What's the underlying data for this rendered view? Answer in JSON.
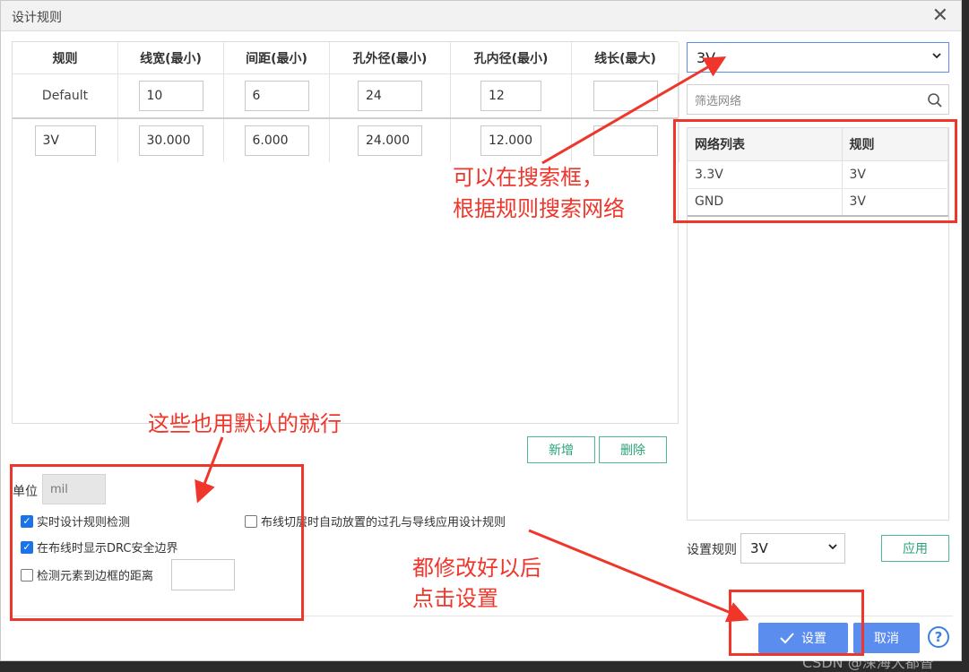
{
  "dialog": {
    "title": "设计规则",
    "close_icon": "close-icon"
  },
  "rules_table": {
    "headers": [
      "规则",
      "线宽(最小)",
      "间距(最小)",
      "孔外径(最小)",
      "孔内径(最小)",
      "线长(最大)"
    ],
    "rows": [
      {
        "name": "Default",
        "width": "10",
        "spacing": "6",
        "via_outer": "24",
        "via_inner": "12",
        "length": ""
      },
      {
        "name": "3V",
        "width": "30.000",
        "spacing": "6.000",
        "via_outer": "24.000",
        "via_inner": "12.000",
        "length": ""
      }
    ],
    "add_label": "新增",
    "delete_label": "删除"
  },
  "settings": {
    "unit_label": "单位",
    "unit_value": "mil",
    "realtime_drc": {
      "label": "实时设计规则检测",
      "checked": true
    },
    "show_drc_boundary": {
      "label": "在布线时显示DRC安全边界",
      "checked": true
    },
    "check_element_distance": {
      "label": "检测元素到边框的距离",
      "checked": false,
      "value": ""
    },
    "auto_via_rule": {
      "label": "布线切层时自动放置的过孔与导线应用设计规则",
      "checked": false
    }
  },
  "net_panel": {
    "selected_rule": "3V",
    "filter_placeholder": "筛选网络",
    "headers": [
      "网络列表",
      "规则"
    ],
    "rows": [
      {
        "net": "3.3V",
        "rule": "3V"
      },
      {
        "net": "GND",
        "rule": "3V"
      }
    ],
    "apply_rule_label": "设置规则",
    "apply_rule_value": "3V",
    "apply_button": "应用"
  },
  "footer": {
    "ok_label": "设置",
    "cancel_label": "取消",
    "help_label": "?"
  },
  "annotations": {
    "search_note_line1": "可以在搜索框，",
    "search_note_line2": "根据规则搜索网络",
    "default_note": "这些也用默认的就行",
    "done_note_line1": "都修改好以后",
    "done_note_line2": "点击设置"
  },
  "watermark": "CSDN @深海大都督",
  "colors": {
    "accent": "#5b8def",
    "annotation": "#f0352a",
    "outline_green": "#4db894"
  }
}
